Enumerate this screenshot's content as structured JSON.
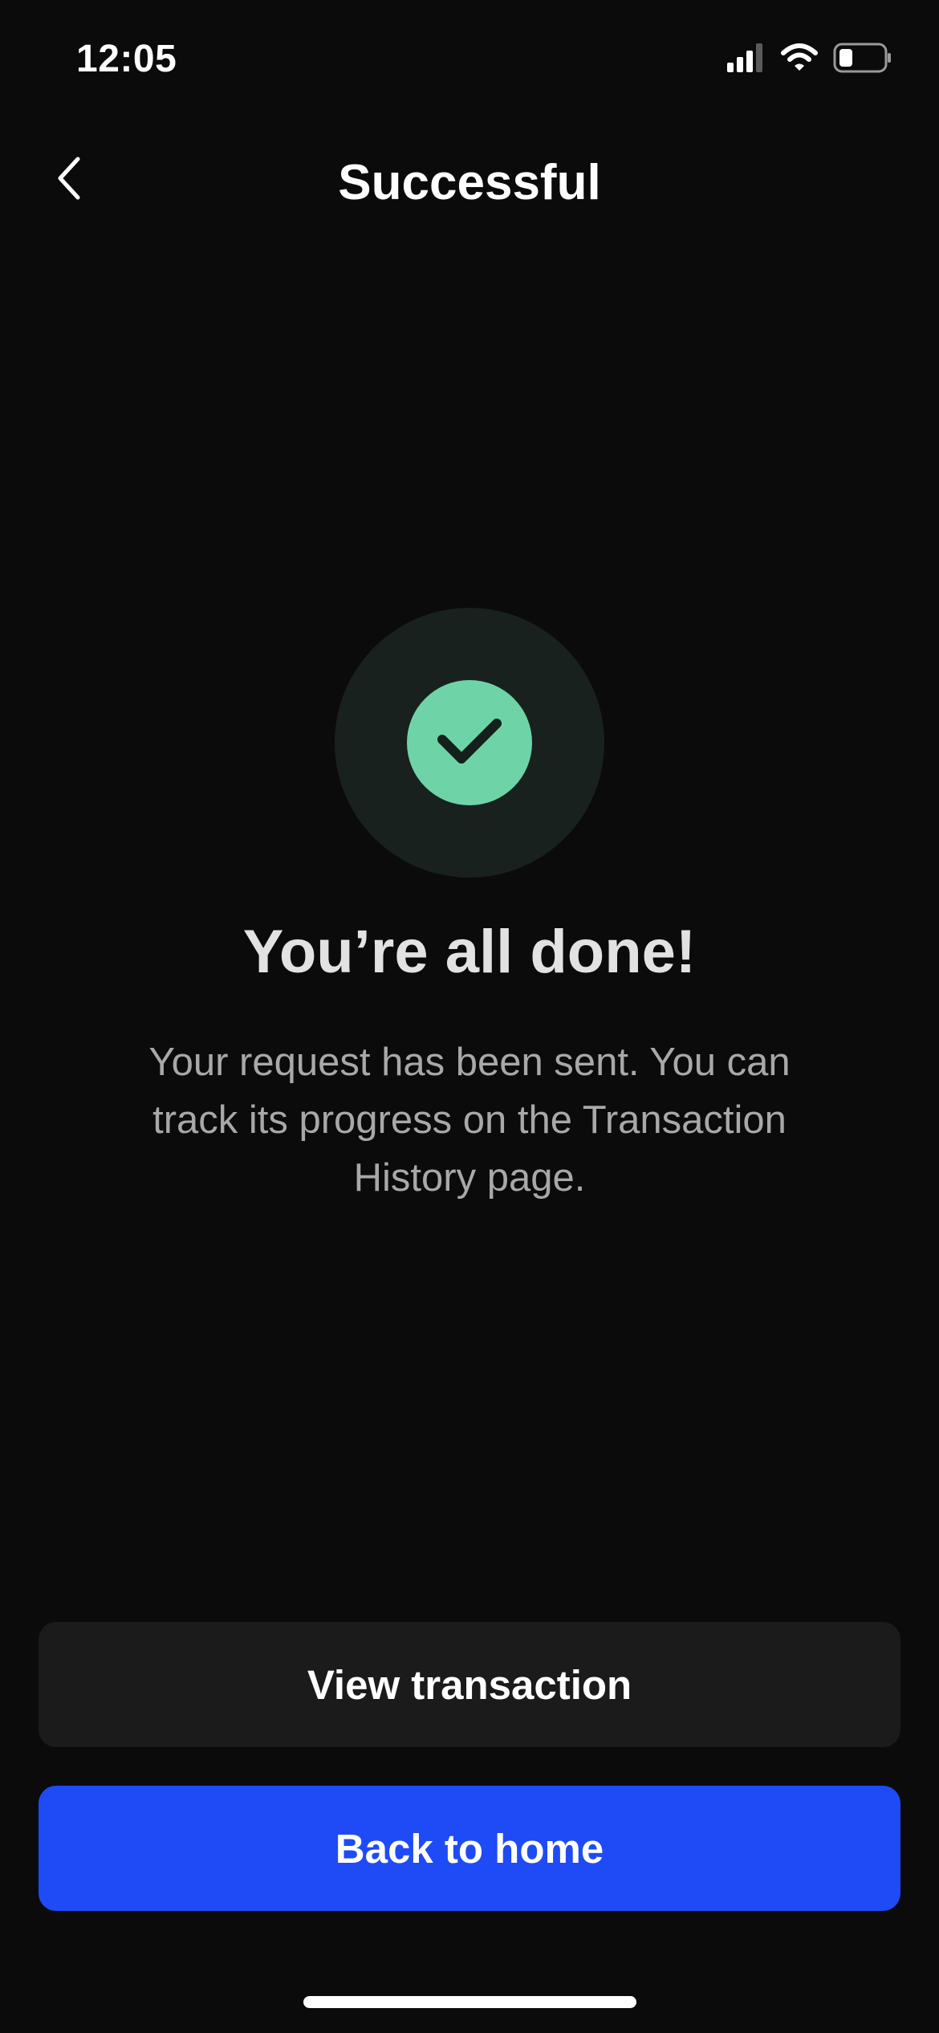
{
  "status_bar": {
    "time": "12:05",
    "icons": [
      "cellular-signal-icon",
      "wifi-icon",
      "battery-icon"
    ]
  },
  "nav": {
    "back_icon": "chevron-left-icon",
    "title": "Successful"
  },
  "success": {
    "icon": "check-icon",
    "title": "You’re all done!",
    "message": "Your request has been sent. You can track its progress on the Transaction History page."
  },
  "actions": {
    "view_transaction_label": "View transaction",
    "back_home_label": "Back to home"
  },
  "colors": {
    "background": "#0b0b0b",
    "accent_blue": "#1e4bf5",
    "success_green": "#6ed4a8",
    "success_ring": "#18211e",
    "secondary_button": "#1b1b1b"
  }
}
